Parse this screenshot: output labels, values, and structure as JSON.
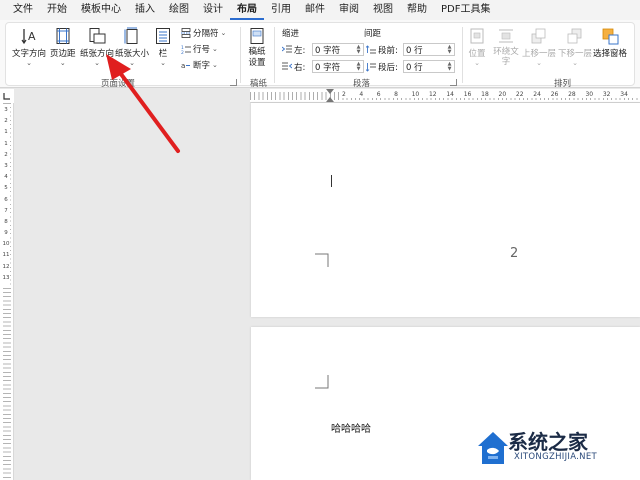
{
  "menu": {
    "tabs": [
      "文件",
      "开始",
      "模板中心",
      "插入",
      "绘图",
      "设计",
      "布局",
      "引用",
      "邮件",
      "审阅",
      "视图",
      "帮助",
      "PDF工具集"
    ],
    "active": "布局"
  },
  "ribbon": {
    "page_setup": {
      "text_direction": "文字方向",
      "margins": "页边距",
      "orientation": "纸张方向",
      "size": "纸张大小",
      "columns": "栏",
      "breaks": "分隔符",
      "line_numbers": "行号",
      "hyphenation": "断字",
      "group_label": "页面设置"
    },
    "draft": {
      "button": "稿纸设置",
      "group_label": "稿纸"
    },
    "paragraph": {
      "indent_header": "缩进",
      "spacing_header": "间距",
      "left_label": "左:",
      "left_value": "0 字符",
      "right_label": "右:",
      "right_value": "0 字符",
      "before_label": "段前:",
      "before_value": "0 行",
      "after_label": "段后:",
      "after_value": "0 行",
      "group_label": "段落"
    },
    "arrange": {
      "position": "位置",
      "wrap_text": "环绕文字",
      "bring_forward": "上移一层",
      "send_backward": "下移一层",
      "selection_pane": "选择窗格",
      "group_label": "排列"
    }
  },
  "ruler": {
    "h_numbers": [
      "2",
      "4",
      "6",
      "8",
      "10",
      "12",
      "14",
      "16",
      "18",
      "20",
      "22",
      "24",
      "26",
      "28",
      "30",
      "32",
      "34"
    ],
    "v_numbers": [
      "3",
      "2",
      "1",
      "1",
      "2",
      "3",
      "4",
      "5",
      "6",
      "7",
      "8",
      "9",
      "10",
      "11",
      "12",
      "13"
    ]
  },
  "document": {
    "page_number": "2",
    "body_text": "哈哈哈哈"
  },
  "watermark": {
    "title": "系统之家",
    "subtitle": "XITONGZHIJIA.NET"
  },
  "colors": {
    "accent": "#2b6ccf",
    "arrow": "#e01f1f",
    "watermark_blue": "#1f6fd0"
  }
}
